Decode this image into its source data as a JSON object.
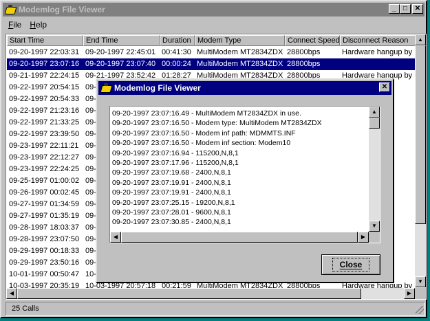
{
  "window": {
    "title": "Modemlog File Viewer"
  },
  "menu": {
    "items": [
      "File",
      "Help"
    ]
  },
  "table": {
    "columns": [
      "Start Time",
      "End Time",
      "Duration",
      "Modem Type",
      "Connect Speed",
      "Disconnect Reason"
    ],
    "rows": [
      [
        "09-20-1997 22:03:31",
        "09-20-1997 22:45:01",
        "00:41:30",
        "MultiModem MT2834ZDX",
        "28800bps",
        "Hardware hangup by"
      ],
      [
        "09-20-1997 23:07:16",
        "09-20-1997 23:07:40",
        "00:00:24",
        "MultiModem MT2834ZDX",
        "28800bps",
        ""
      ],
      [
        "09-21-1997 22:24:15",
        "09-21-1997 23:52:42",
        "01:28:27",
        "MultiModem MT2834ZDX",
        "28800bps",
        "Hardware hangup by"
      ],
      [
        "09-22-1997 20:54:15",
        "09-",
        "",
        "",
        "",
        ""
      ],
      [
        "09-22-1997 20:54:33",
        "09-",
        "",
        "",
        "",
        ""
      ],
      [
        "09-22-1997 21:23:16",
        "09-",
        "",
        "",
        "",
        ""
      ],
      [
        "09-22-1997 21:33:25",
        "09-",
        "",
        "",
        "",
        "up by"
      ],
      [
        "09-22-1997 23:39:50",
        "09-",
        "",
        "",
        "",
        "up by"
      ],
      [
        "09-23-1997 22:11:21",
        "09-",
        "",
        "",
        "",
        ""
      ],
      [
        "09-23-1997 22:12:27",
        "09-",
        "",
        "",
        "",
        "hung"
      ],
      [
        "09-23-1997 22:24:25",
        "09-",
        "",
        "",
        "",
        "hung"
      ],
      [
        "09-25-1997 01:00:02",
        "09-",
        "",
        "",
        "",
        "up by"
      ],
      [
        "09-26-1997 00:02:45",
        "09-",
        "",
        "",
        "",
        "up by"
      ],
      [
        "09-27-1997 01:34:59",
        "09-",
        "",
        "",
        "",
        ""
      ],
      [
        "09-27-1997 01:35:19",
        "09-",
        "",
        "",
        "",
        ""
      ],
      [
        "09-28-1997 18:03:37",
        "09-",
        "",
        "",
        "",
        "up by"
      ],
      [
        "09-28-1997 23:07:50",
        "09-",
        "",
        "",
        "",
        "up by"
      ],
      [
        "09-29-1997 00:18:33",
        "09-",
        "",
        "",
        "",
        "up by"
      ],
      [
        "09-29-1997 23:50:16",
        "09-",
        "",
        "",
        "",
        "up by"
      ],
      [
        "10-01-1997 00:50:47",
        "10-",
        "",
        "",
        "",
        "up by"
      ],
      [
        "10-03-1997 20:35:19",
        "10-03-1997 20:57:18",
        "00:21:59",
        "MultiModem MT2834ZDX",
        "28800bps",
        "Hardware hangup by"
      ]
    ],
    "selected_row": 1
  },
  "status": {
    "text": "25 Calls"
  },
  "dialog": {
    "title": "Modemlog File Viewer",
    "log_lines": [
      "09-20-1997 23:07:16.49 - MultiModem MT2834ZDX in use.",
      "09-20-1997 23:07:16.50 - Modem type: MultiModem MT2834ZDX",
      "09-20-1997 23:07:16.50 - Modem inf path: MDMMTS.INF",
      "09-20-1997 23:07:16.50 - Modem inf section: Modem10",
      "09-20-1997 23:07:16.94 - 115200,N,8,1",
      "09-20-1997 23:07:17.96 - 115200,N,8,1",
      "09-20-1997 23:07:19.68 - 2400,N,8,1",
      "09-20-1997 23:07:19.91 - 2400,N,8,1",
      "09-20-1997 23:07:19.91 - 2400,N,8,1",
      "09-20-1997 23:07:25.15 - 19200,N,8,1",
      "09-20-1997 23:07:28.01 - 9600,N,8,1",
      "09-20-1997 23:07:30.85 - 2400,N,8,1"
    ],
    "close_label": "Close"
  },
  "icons": {
    "app": "modem-icon",
    "minimize": "minimize-icon",
    "maximize": "maximize-icon",
    "close": "close-icon"
  },
  "colors": {
    "selection": "#000080",
    "active_title": "#000080",
    "inactive_title": "#808080",
    "face": "#c0c0c0"
  }
}
